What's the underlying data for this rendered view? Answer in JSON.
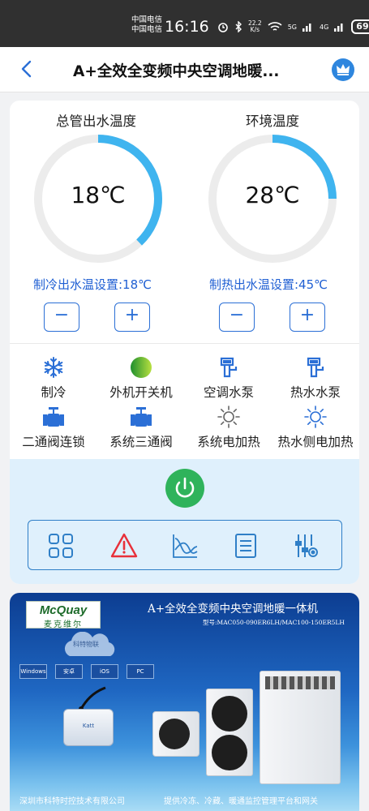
{
  "status_bar": {
    "carrier_1": "中国电信",
    "carrier_2": "中国电信",
    "time": "16:16",
    "net_speed": "22.2",
    "net_unit": "K/s",
    "signal_1": "5G",
    "signal_2": "4G",
    "battery": "69"
  },
  "header": {
    "title": "A+全效全变频中央空调地暖..."
  },
  "gauges": {
    "outlet": {
      "title": "总管出水温度",
      "value": "18℃",
      "fill_fraction": 0.38
    },
    "ambient": {
      "title": "环境温度",
      "value": "28℃",
      "fill_fraction": 0.25
    }
  },
  "setpoints": {
    "cooling": "制冷出水温设置:18℃",
    "heating": "制热出水温设置:45℃",
    "minus": "−",
    "plus": "+"
  },
  "functions": [
    {
      "label": "制冷",
      "icon": "snowflake-icon"
    },
    {
      "label": "外机开关机",
      "icon": "status-dot-icon"
    },
    {
      "label": "空调水泵",
      "icon": "water-pump-icon"
    },
    {
      "label": "热水水泵",
      "icon": "water-pump-icon"
    },
    {
      "label": "二通阀连锁",
      "icon": "valve-icon"
    },
    {
      "label": "系统三通阀",
      "icon": "valve-icon"
    },
    {
      "label": "系统电加热",
      "icon": "sun-icon"
    },
    {
      "label": "热水侧电加热",
      "icon": "sun-icon"
    }
  ],
  "toolbar": [
    "grid-icon",
    "alarm-icon",
    "curve-icon",
    "list-icon",
    "settings-icon"
  ],
  "colors": {
    "accent": "#2b6fd6",
    "gauge_arc": "#3fb4ef",
    "gauge_track": "#ececec",
    "power": "#2fb35b",
    "alarm": "#e8303a",
    "panel_bg": "#dff0fc"
  },
  "banner": {
    "brand": "McQuay",
    "brand_cn": "麦克维尔",
    "title": "A+全效全变频中央空调地暖一体机",
    "model": "型号:MAC050-090ER6LH/MAC100-150ER5LH",
    "cloud": "科特物联",
    "os_labels": [
      "Windows",
      "安卓",
      "iOS",
      "PC"
    ],
    "device": "Katt",
    "footer_left": "深圳市科特时控技术有限公司",
    "footer_right": "提供冷冻、冷藏、暖通监控管理平台和网关"
  }
}
